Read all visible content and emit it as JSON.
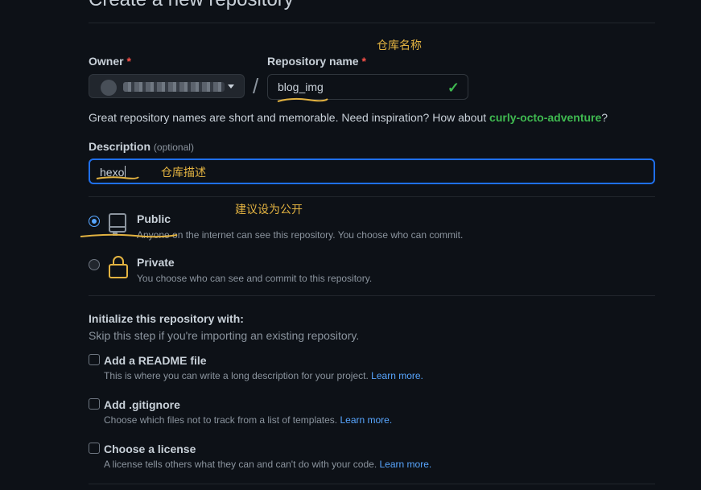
{
  "page": {
    "heading": "Create a new repository"
  },
  "owner": {
    "label": "Owner",
    "required_mark": "*"
  },
  "repo": {
    "label": "Repository name",
    "required_mark": "*",
    "value": "blog_img"
  },
  "separator": "/",
  "hint": {
    "prefix": "Great repository names are short and memorable. Need inspiration? How about ",
    "suggestion": "curly-octo-adventure",
    "suffix": "?"
  },
  "description": {
    "label": "Description",
    "optional": "(optional)",
    "value": "hexo"
  },
  "visibility": {
    "public": {
      "title": "Public",
      "sub": "Anyone on the internet can see this repository. You choose who can commit.",
      "selected": true
    },
    "private": {
      "title": "Private",
      "sub": "You choose who can see and commit to this repository.",
      "selected": false
    }
  },
  "init": {
    "title": "Initialize this repository with:",
    "sub": "Skip this step if you're importing an existing repository.",
    "readme": {
      "title": "Add a README file",
      "sub": "This is where you can write a long description for your project.",
      "link": "Learn more."
    },
    "gitignore": {
      "title": "Add .gitignore",
      "sub": "Choose which files not to track from a list of templates.",
      "link": "Learn more."
    },
    "license": {
      "title": "Choose a license",
      "sub": "A license tells others what they can and can't do with your code.",
      "link": "Learn more."
    }
  },
  "annotations": {
    "repo_name": "仓库名称",
    "description": "仓库描述",
    "visibility": "建议设为公开"
  },
  "colors": {
    "accent": "#58a6ff",
    "success": "#3fb950",
    "annotation": "#e3b341",
    "background": "#0d1117"
  }
}
